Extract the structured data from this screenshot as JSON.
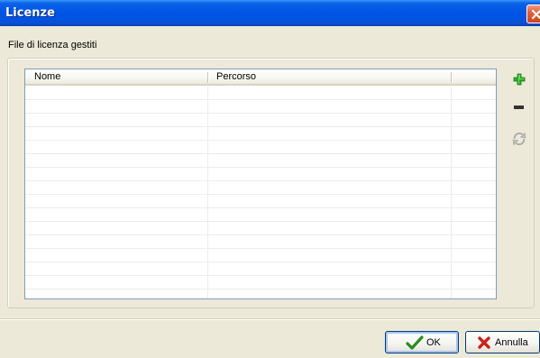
{
  "window": {
    "title": "Licenze"
  },
  "group": {
    "label": "File di licenza gestiti"
  },
  "table": {
    "columns": [
      "Nome",
      "Percorso",
      ""
    ],
    "rows": []
  },
  "side_buttons": [
    {
      "name": "add",
      "icon": "plus-icon",
      "color": "#2faa2a"
    },
    {
      "name": "remove",
      "icon": "minus-icon",
      "color": "#333333"
    },
    {
      "name": "refresh",
      "icon": "refresh-icon",
      "color": "#b0b0b0"
    }
  ],
  "footer": {
    "ok_label": "OK",
    "cancel_label": "Annulla"
  },
  "colors": {
    "titlebar": "#0054e3",
    "dialog_bg": "#ece9d8",
    "ok_check": "#2c8a1f",
    "cancel_x": "#c8241a"
  }
}
